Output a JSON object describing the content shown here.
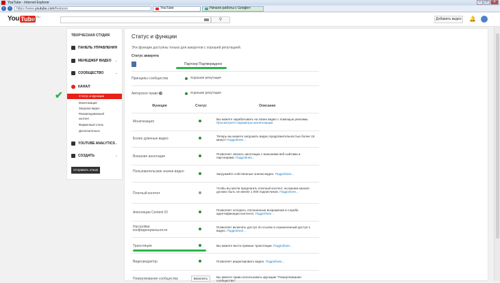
{
  "window": {
    "title": "YouTube - Internet Explorer"
  },
  "browser": {
    "url_prefix": "https://www.",
    "url_domain": "youtube.com",
    "url_path": "/features",
    "tabs": [
      {
        "label": "YouTube"
      },
      {
        "label": "Начало работы с Google+"
      }
    ]
  },
  "header": {
    "logo_you": "You",
    "logo_tube": "Tube",
    "logo_region": "RU",
    "upload_label": "Добавить видео"
  },
  "sidebar": {
    "title": "ТВОРЧЕСКАЯ СТУДИЯ",
    "sections": [
      {
        "label": "ПАНЕЛЬ УПРАВЛЕНИЯ"
      },
      {
        "label": "МЕНЕДЖЕР ВИДЕО"
      },
      {
        "label": "СООБЩЕСТВО"
      },
      {
        "label": "КАНАЛ"
      },
      {
        "label": "YOUTUBE ANALYTICS"
      },
      {
        "label": "СОЗДАТЬ"
      }
    ],
    "channel_items": [
      {
        "label": "Статус и функции"
      },
      {
        "label": "Монетизация"
      },
      {
        "label": "Загрузка видео"
      },
      {
        "label": "Рекомендованный"
      },
      {
        "label": "контент"
      },
      {
        "label": "Фирменный стиль"
      },
      {
        "label": "Дополнительно"
      }
    ],
    "feedback_button": "Отправить отзыв"
  },
  "main": {
    "title": "Статус и функции",
    "intro": "Эти функции доступны только для аккаунтов с хорошей репутацией.",
    "account_status_label": "Статус аккаунта",
    "partner_label": "Партнер Подтверждено",
    "community_label": "Принципы сообщества",
    "community_value": "Хорошая репутация",
    "copyright_label": "Авторское право",
    "copyright_value": "Хорошая репутация",
    "table_headers": {
      "feature": "Функция",
      "status": "Статус",
      "description": "Описание"
    },
    "link_more": "Подробнее...",
    "features": [
      {
        "name": "Монетизация",
        "desc": "Вы можете зарабатывать на своих видео с помощью рекламы.",
        "link": "Просмотрите параметры монетизации.",
        "status": "on"
      },
      {
        "name": "Более длинные видео",
        "desc": "Теперь вы можете загружать видео продолжительностью более 15 минут!",
        "link": "Подробнее...",
        "status": "on"
      },
      {
        "name": "Внешние аннотации",
        "desc": "Позволяет связать аннотации с внешними веб-сайтами и партнерами.",
        "link": "Подробнее...",
        "status": "on"
      },
      {
        "name": "Пользовательские значки видео",
        "desc": "Загружайте собственные значки видео.",
        "link": "Подробнее...",
        "status": "on"
      },
      {
        "name": "Платный контент",
        "desc": "Чтобы вы могли предлагать платный контент, на вашем канале должно быть не менее 1 000 подписчиков.",
        "link": "Подробнее...",
        "status": "off"
      },
      {
        "name": "Апелляции Content ID",
        "desc": "Позволяет оспорить отклоненные возражения в службе идентификации контента.",
        "link": "Подробнее...",
        "status": "on"
      },
      {
        "name": "Настройки конфиденциальности",
        "desc": "Позволяет включать доступ по ссылке и ограниченный доступ к видео.",
        "link": "Подробнее...",
        "status": "on"
      },
      {
        "name": "Трансляции",
        "desc": "Вы можете вести прямые трансляции.",
        "link": "Подробнее...",
        "status": "on"
      },
      {
        "name": "Видеоредактор",
        "desc": "Позволяет редактировать видео.",
        "link": "Подробнее...",
        "status": "on"
      },
      {
        "name": "Пожертвования сообщества",
        "desc": "Вы имеете право использовать функцию \"Пожертвования сообщества\".",
        "link": "",
        "status": "button"
      }
    ],
    "enable_button": "Включить"
  },
  "colors": {
    "accent": "#e62117",
    "ok": "#2e8b3a",
    "link": "#167ac6",
    "highlight": "#2cb34a"
  }
}
